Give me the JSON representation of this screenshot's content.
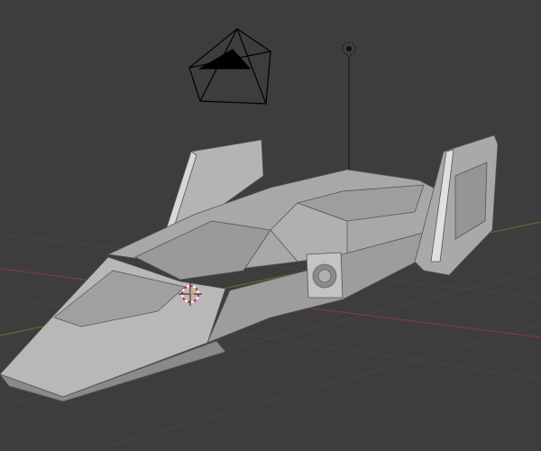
{
  "viewport": {
    "background": "#3d3d3d",
    "grid_color": "#464646",
    "x_axis_color": "#8a3a48",
    "y_axis_color": "#5f7a2e"
  },
  "objects": {
    "camera": {
      "icon": "camera-icon",
      "color": "#000000"
    },
    "light": {
      "icon": "light-icon",
      "color": "#111111"
    },
    "cursor": {
      "icon": "3d-cursor-icon",
      "colors": [
        "#e02020",
        "#ffffff"
      ]
    },
    "mesh": {
      "name_icon": "spaceship-mesh",
      "base_color": "#a6a6a6"
    }
  }
}
